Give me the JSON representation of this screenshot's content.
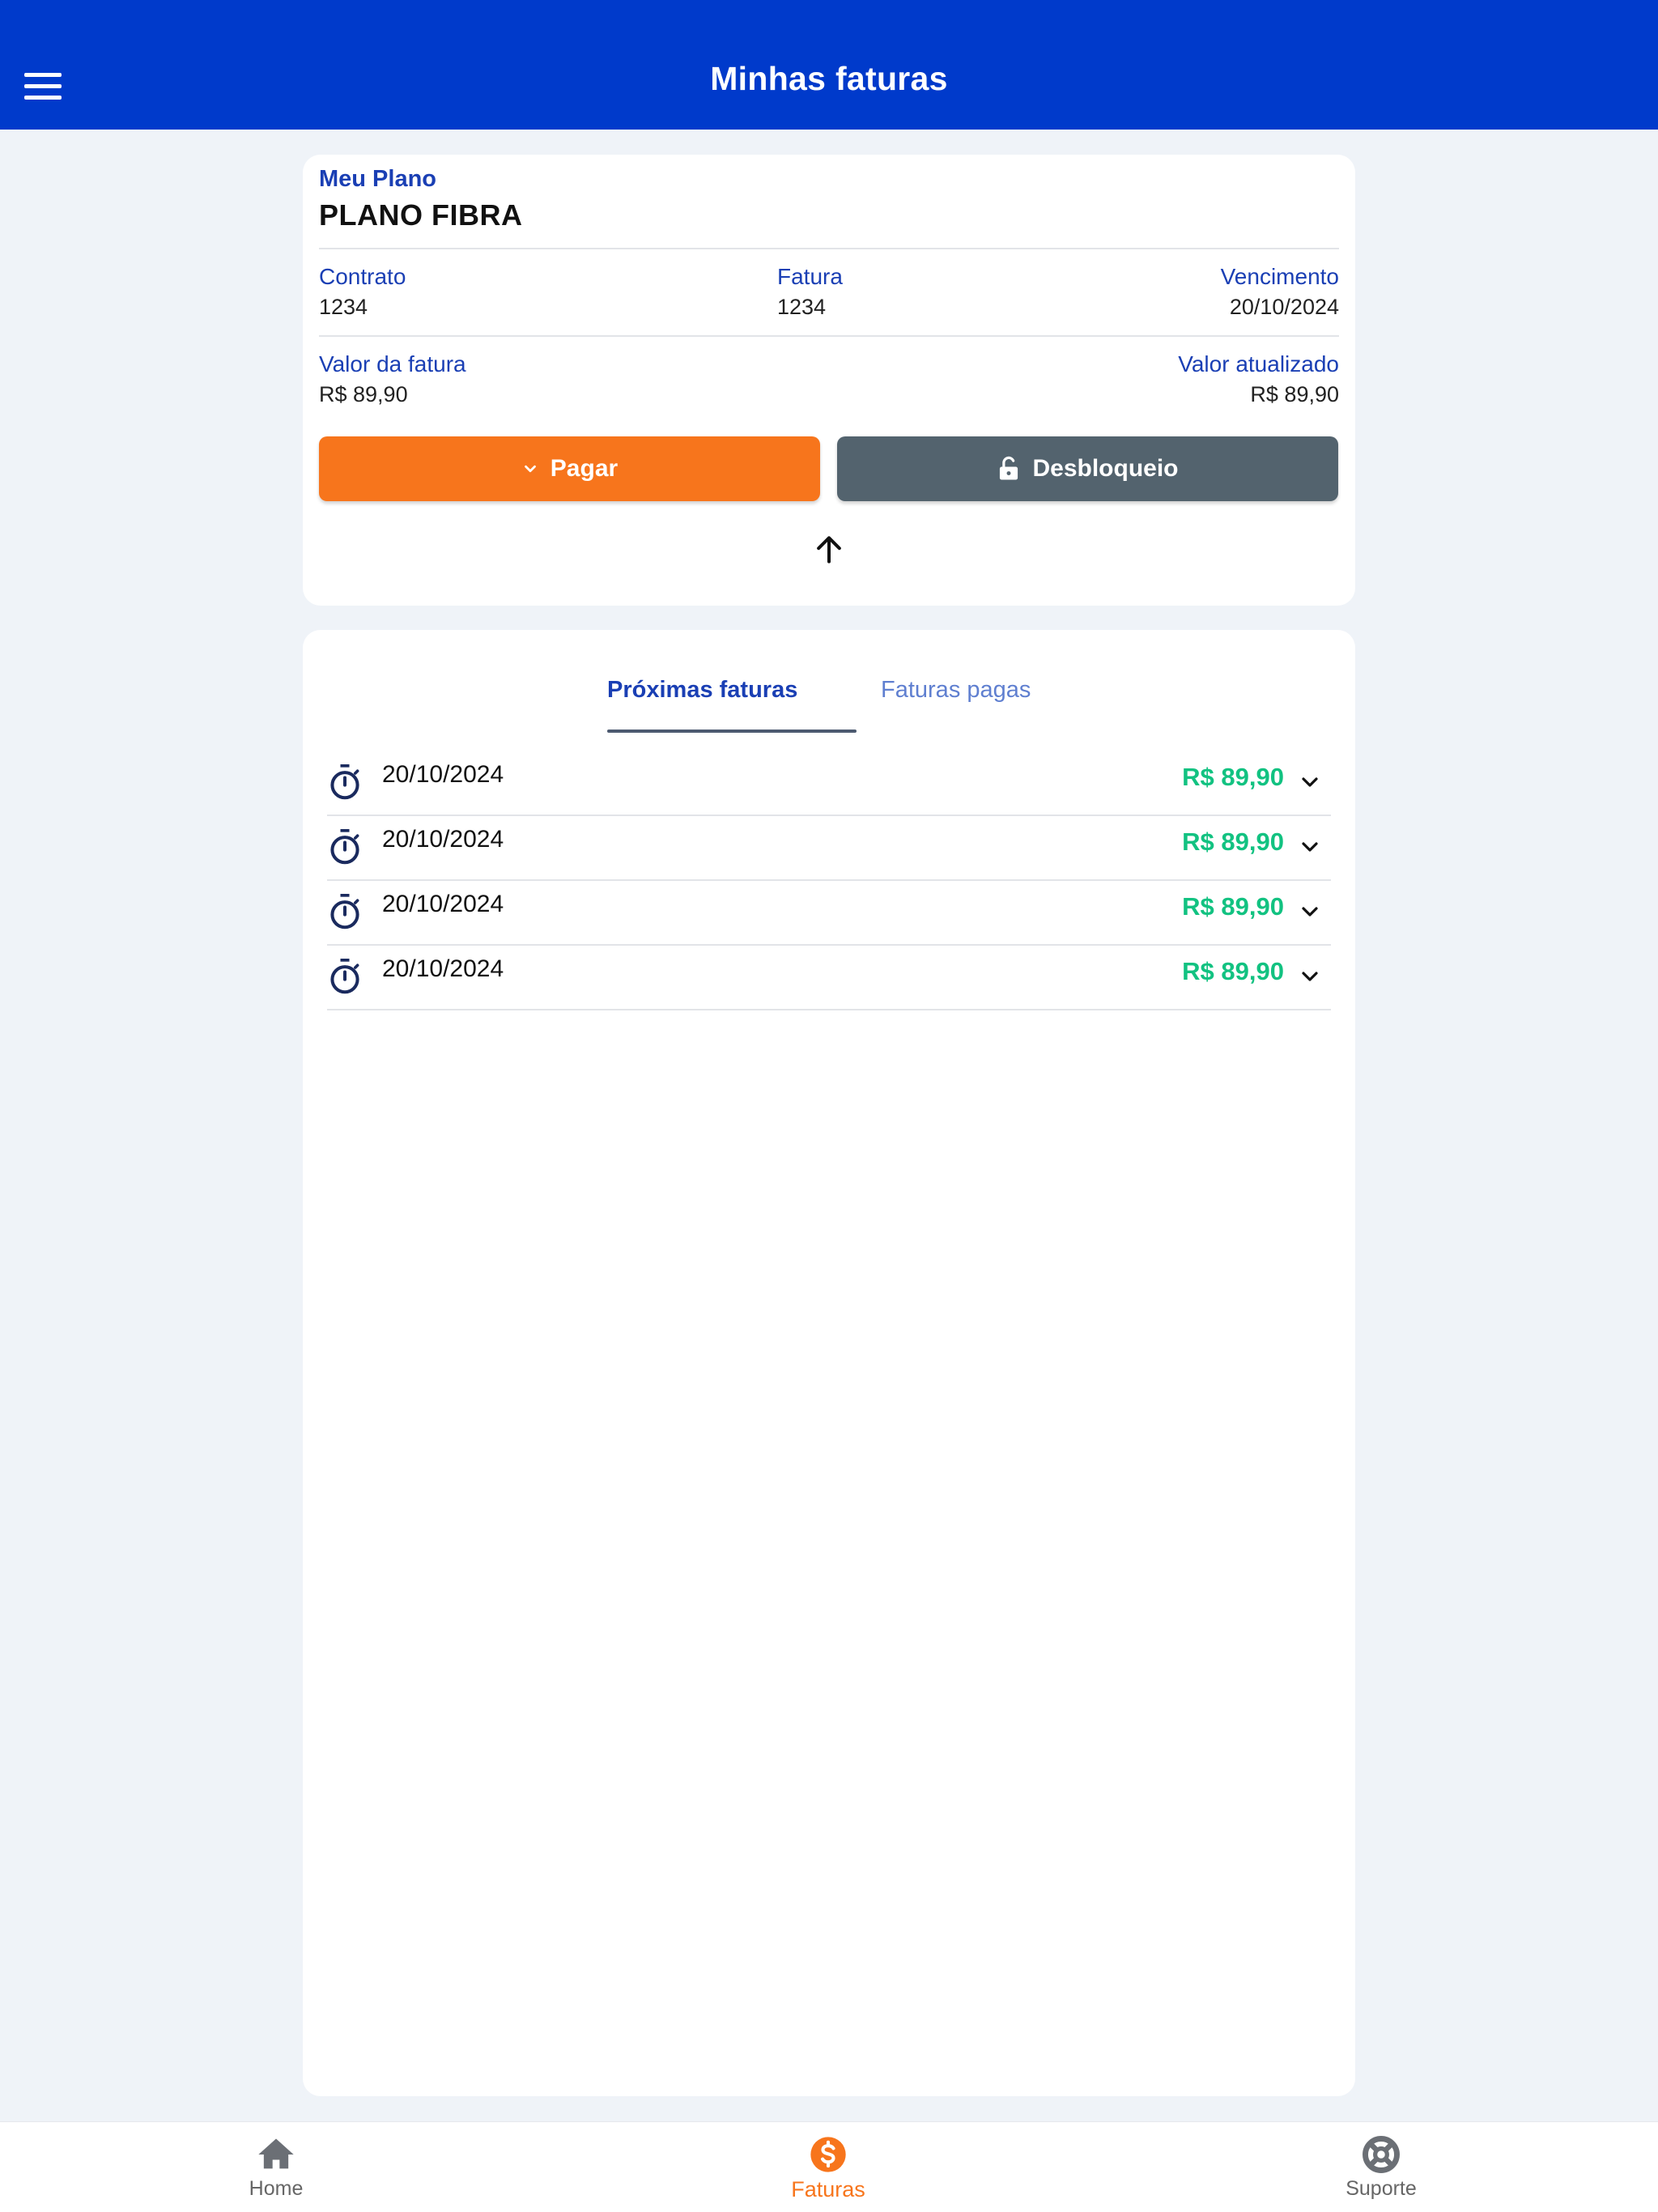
{
  "header": {
    "title": "Minhas faturas",
    "menu_icon": "hamburger-menu-icon"
  },
  "plan": {
    "section_label": "Meu Plano",
    "name": "PLANO FIBRA",
    "contract": {
      "label": "Contrato",
      "value": "1234"
    },
    "invoice": {
      "label": "Fatura",
      "value": "1234"
    },
    "due": {
      "label": "Vencimento",
      "value": "20/10/2024"
    },
    "invoice_value": {
      "label": "Valor da fatura",
      "value": "R$ 89,90"
    },
    "updated_value": {
      "label": "Valor atualizado",
      "value": "R$ 89,90"
    },
    "pay_button": "Pagar",
    "unlock_button": "Desbloqueio"
  },
  "tabs": [
    {
      "label": "Próximas faturas",
      "active": true
    },
    {
      "label": "Faturas pagas",
      "active": false
    }
  ],
  "invoices": [
    {
      "date": "20/10/2024",
      "amount": "R$ 89,90"
    },
    {
      "date": "20/10/2024",
      "amount": "R$ 89,90"
    },
    {
      "date": "20/10/2024",
      "amount": "R$ 89,90"
    },
    {
      "date": "20/10/2024",
      "amount": "R$ 89,90"
    }
  ],
  "bottom_nav": [
    {
      "label": "Home",
      "icon": "home-icon"
    },
    {
      "label": "Faturas",
      "icon": "dollar-icon",
      "active": true
    },
    {
      "label": "Suporte",
      "icon": "lifebuoy-icon"
    }
  ],
  "colors": {
    "primary": "#003acb",
    "accent": "#f7751c",
    "unlock": "#53636e",
    "amount": "#12c281",
    "link": "#1a3fb4"
  }
}
